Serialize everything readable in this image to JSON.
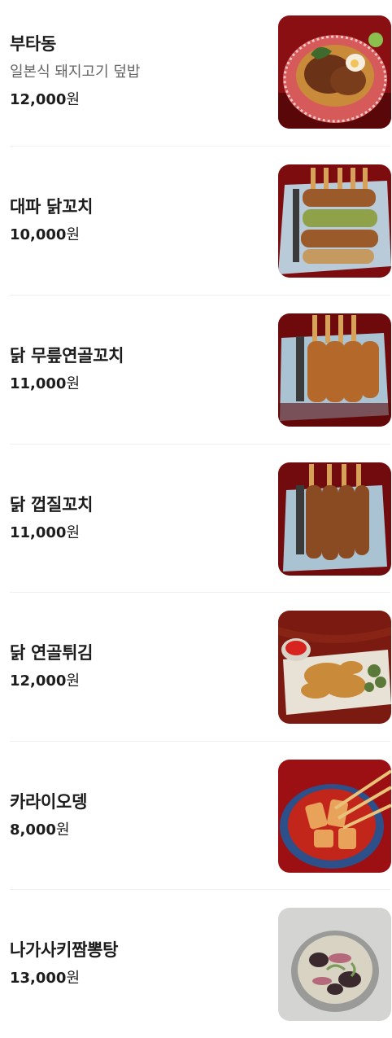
{
  "menu": {
    "items": [
      {
        "name": "부타동",
        "description": "일본식 돼지고기 덮밥",
        "price": "12,000",
        "unit": "원",
        "image": "pork-rice-bowl-photo"
      },
      {
        "name": "대파 닭꼬치",
        "price": "10,000",
        "unit": "원",
        "image": "green-onion-chicken-skewers-photo"
      },
      {
        "name": "닭 무릎연골꼬치",
        "price": "11,000",
        "unit": "원",
        "image": "chicken-knee-cartilage-skewers-photo"
      },
      {
        "name": "닭 껍질꼬치",
        "price": "11,000",
        "unit": "원",
        "image": "chicken-skin-skewers-photo"
      },
      {
        "name": "닭 연골튀김",
        "price": "12,000",
        "unit": "원",
        "image": "fried-chicken-cartilage-photo"
      },
      {
        "name": "카라이오뎅",
        "price": "8,000",
        "unit": "원",
        "image": "spicy-fish-cake-photo"
      },
      {
        "name": "나가사키짬뽕탕",
        "price": "13,000",
        "unit": "원",
        "image": "nagasaki-champon-soup-photo"
      }
    ]
  }
}
